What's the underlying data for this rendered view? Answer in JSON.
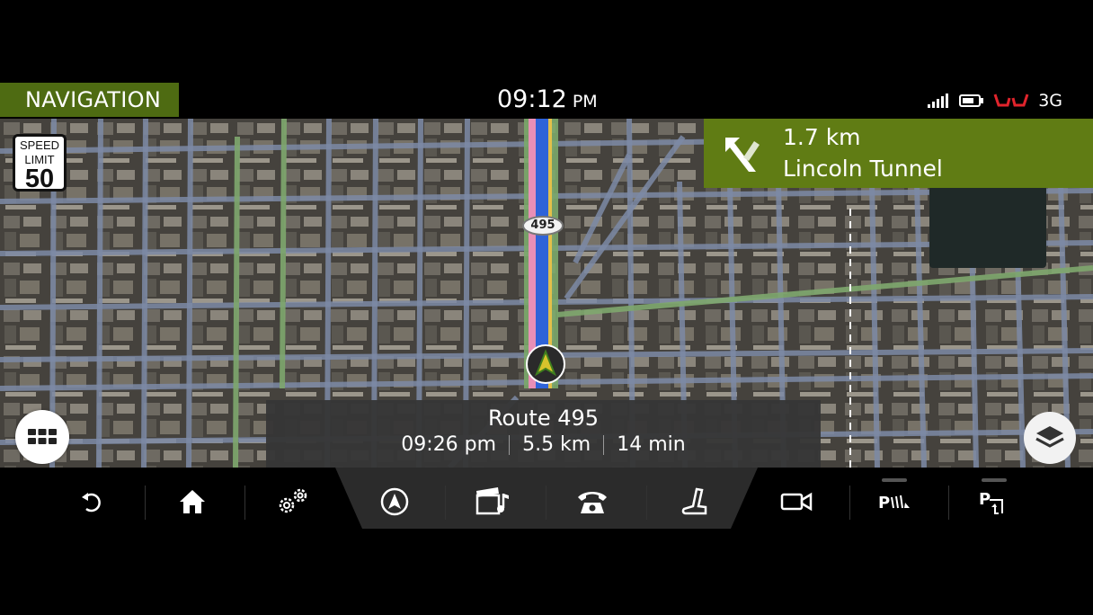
{
  "status_bar": {
    "app_title": "NAVIGATION",
    "time": "09:12",
    "ampm": "PM",
    "network": "3G",
    "icons": [
      "signal-icon",
      "battery-icon",
      "seat-belt-icon"
    ]
  },
  "speed_limit": {
    "label_line1": "SPEED",
    "label_line2": "LIMIT",
    "value": "50"
  },
  "turn": {
    "distance": "1.7 km",
    "street": "Lincoln Tunnel",
    "icon": "turn-left-ramp-icon"
  },
  "map": {
    "route_shield": "495"
  },
  "route": {
    "name": "Route 495",
    "arrival": "09:26 pm",
    "distance": "5.5 km",
    "duration": "14 min"
  },
  "bottom_nav": {
    "items": [
      "back-icon",
      "home-icon",
      "settings-icon",
      "navigation-icon",
      "media-icon",
      "phone-icon",
      "seat-icon",
      "camera-icon",
      "park-assist-icon",
      "park-exit-icon"
    ]
  },
  "colors": {
    "accent_green": "#4e6b12",
    "turn_panel_green": "#607c14",
    "route_blue": "#2f63d8",
    "route_pink": "#e88fb6",
    "alert_red": "#e0242c"
  }
}
